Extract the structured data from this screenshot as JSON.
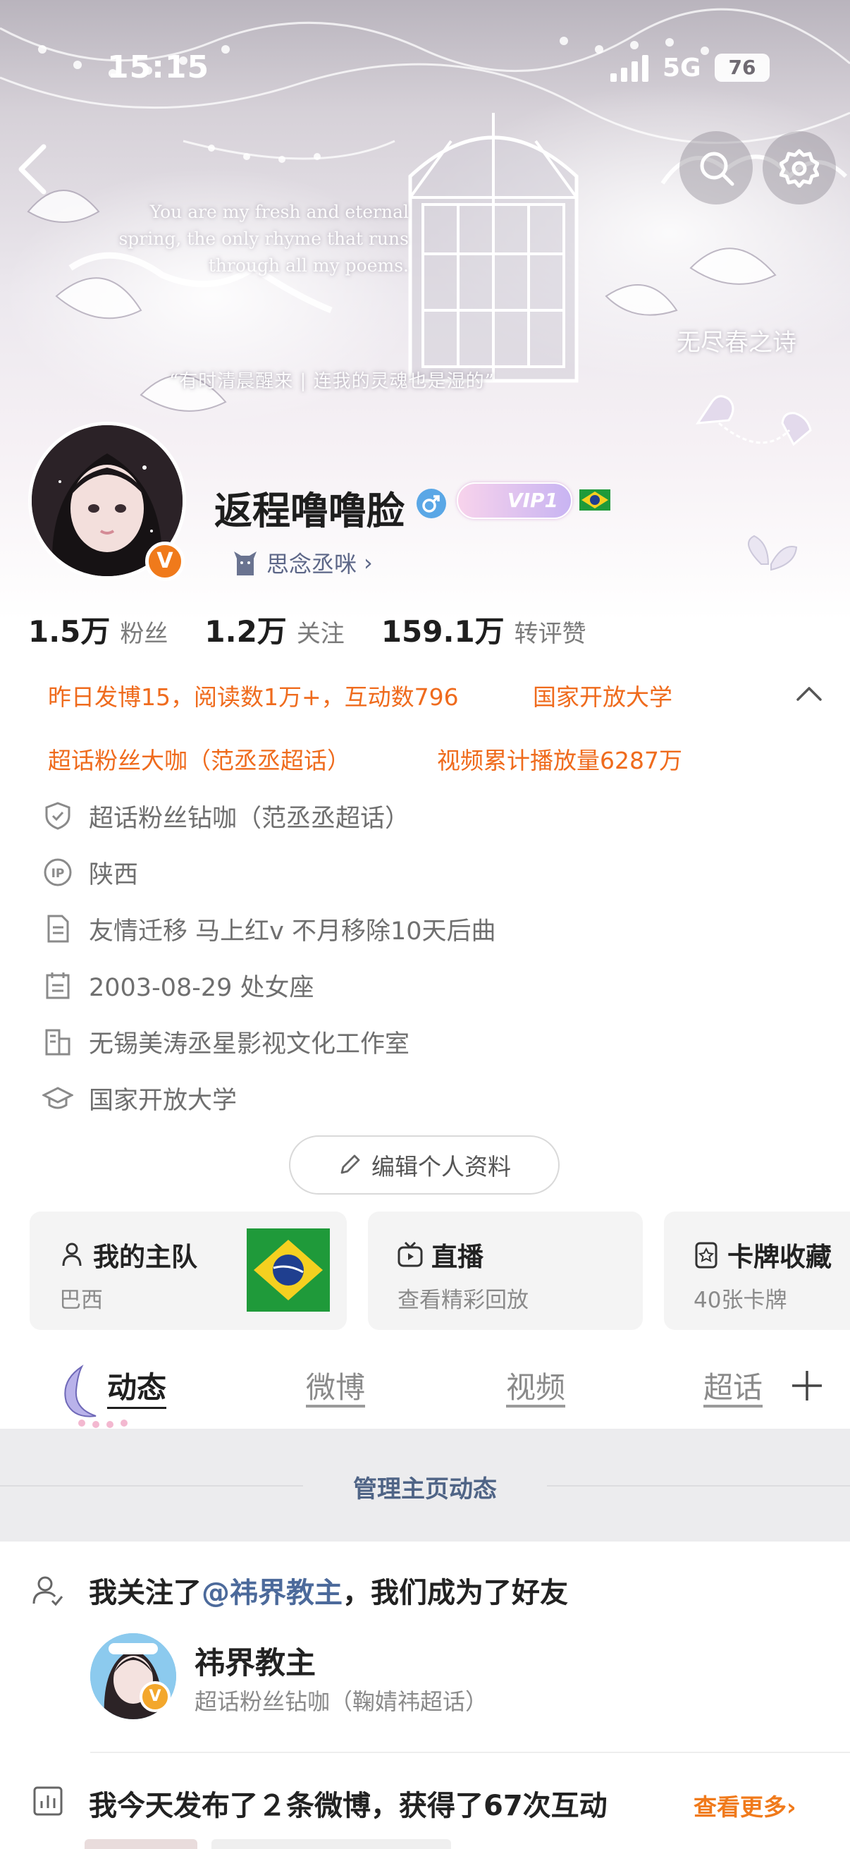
{
  "status_bar": {
    "time": "15:15",
    "network": "5G",
    "battery": "76"
  },
  "banner": {
    "quote": "You are my fresh and eternal spring, the only rhyme that runs through all my poems.",
    "sub_text": "“有时清晨醒来 | 连我的灵魂也是湿的”",
    "script_text": "无尽春之诗"
  },
  "profile": {
    "name": "返程噜噜脸",
    "vip_label": "VIP1",
    "verified_mark": "V",
    "group_tag": "思念丞咪"
  },
  "stats": [
    {
      "value": "1.5万",
      "label": "粉丝"
    },
    {
      "value": "1.2万",
      "label": "关注"
    },
    {
      "value": "159.1万",
      "label": "转评赞"
    }
  ],
  "highlights": {
    "yesterday": "昨日发博15，阅读数1万+，互动数796",
    "school": "国家开放大学",
    "supertopic": "超话粉丝大咖（范丞丞超话）",
    "video": "视频累计播放量6287万"
  },
  "info": [
    {
      "icon": "shield-icon",
      "text": "超话粉丝钻咖（范丞丞超话）"
    },
    {
      "icon": "ip-icon",
      "text": "陕西"
    },
    {
      "icon": "document-icon",
      "text": "友情迁移 马上红v 不月移除10天后曲"
    },
    {
      "icon": "calendar-icon",
      "text": "2003-08-29 处女座"
    },
    {
      "icon": "building-icon",
      "text": "无锡美涛丞星影视文化工作室"
    },
    {
      "icon": "graduation-cap-icon",
      "text": "国家开放大学"
    }
  ],
  "edit_profile_label": "编辑个人资料",
  "cards": [
    {
      "title": "我的主队",
      "subtitle": "巴西"
    },
    {
      "title": "直播",
      "subtitle": "查看精彩回放"
    },
    {
      "title": "卡牌收藏",
      "subtitle": "40张卡牌"
    }
  ],
  "tabs": [
    "动态",
    "微博",
    "视频",
    "超话"
  ],
  "manage_label": "管理主页动态",
  "feed": {
    "follow_prefix": "我关注了",
    "follow_mention": "@祎界教主",
    "follow_suffix": "，我们成为了好友",
    "friend_name": "祎界教主",
    "friend_desc": "超话粉丝钻咖（鞠婧祎超话）",
    "friend_badge": "V",
    "post_summary": "我今天发布了２条微博，获得了67次互动",
    "more_label": "查看更多",
    "more_chevron": "›"
  },
  "colors": {
    "accent_orange": "#ef6b1d",
    "link_blue": "#4c6a9b",
    "manage_blue": "#4f6486",
    "brazil_green": "#1f9a3a",
    "brazil_yellow": "#f5d020",
    "brazil_blue": "#1f3f8f"
  }
}
